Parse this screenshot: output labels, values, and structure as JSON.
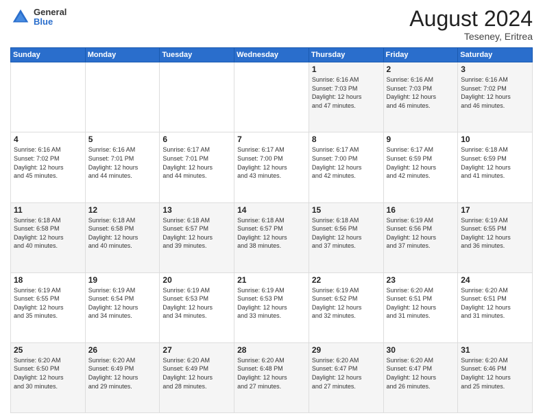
{
  "logo": {
    "general": "General",
    "blue": "Blue"
  },
  "title": "August 2024",
  "subtitle": "Teseney, Eritrea",
  "days_header": [
    "Sunday",
    "Monday",
    "Tuesday",
    "Wednesday",
    "Thursday",
    "Friday",
    "Saturday"
  ],
  "weeks": [
    [
      {
        "day": "",
        "info": ""
      },
      {
        "day": "",
        "info": ""
      },
      {
        "day": "",
        "info": ""
      },
      {
        "day": "",
        "info": ""
      },
      {
        "day": "1",
        "info": "Sunrise: 6:16 AM\nSunset: 7:03 PM\nDaylight: 12 hours\nand 47 minutes."
      },
      {
        "day": "2",
        "info": "Sunrise: 6:16 AM\nSunset: 7:03 PM\nDaylight: 12 hours\nand 46 minutes."
      },
      {
        "day": "3",
        "info": "Sunrise: 6:16 AM\nSunset: 7:02 PM\nDaylight: 12 hours\nand 46 minutes."
      }
    ],
    [
      {
        "day": "4",
        "info": "Sunrise: 6:16 AM\nSunset: 7:02 PM\nDaylight: 12 hours\nand 45 minutes."
      },
      {
        "day": "5",
        "info": "Sunrise: 6:16 AM\nSunset: 7:01 PM\nDaylight: 12 hours\nand 44 minutes."
      },
      {
        "day": "6",
        "info": "Sunrise: 6:17 AM\nSunset: 7:01 PM\nDaylight: 12 hours\nand 44 minutes."
      },
      {
        "day": "7",
        "info": "Sunrise: 6:17 AM\nSunset: 7:00 PM\nDaylight: 12 hours\nand 43 minutes."
      },
      {
        "day": "8",
        "info": "Sunrise: 6:17 AM\nSunset: 7:00 PM\nDaylight: 12 hours\nand 42 minutes."
      },
      {
        "day": "9",
        "info": "Sunrise: 6:17 AM\nSunset: 6:59 PM\nDaylight: 12 hours\nand 42 minutes."
      },
      {
        "day": "10",
        "info": "Sunrise: 6:18 AM\nSunset: 6:59 PM\nDaylight: 12 hours\nand 41 minutes."
      }
    ],
    [
      {
        "day": "11",
        "info": "Sunrise: 6:18 AM\nSunset: 6:58 PM\nDaylight: 12 hours\nand 40 minutes."
      },
      {
        "day": "12",
        "info": "Sunrise: 6:18 AM\nSunset: 6:58 PM\nDaylight: 12 hours\nand 40 minutes."
      },
      {
        "day": "13",
        "info": "Sunrise: 6:18 AM\nSunset: 6:57 PM\nDaylight: 12 hours\nand 39 minutes."
      },
      {
        "day": "14",
        "info": "Sunrise: 6:18 AM\nSunset: 6:57 PM\nDaylight: 12 hours\nand 38 minutes."
      },
      {
        "day": "15",
        "info": "Sunrise: 6:18 AM\nSunset: 6:56 PM\nDaylight: 12 hours\nand 37 minutes."
      },
      {
        "day": "16",
        "info": "Sunrise: 6:19 AM\nSunset: 6:56 PM\nDaylight: 12 hours\nand 37 minutes."
      },
      {
        "day": "17",
        "info": "Sunrise: 6:19 AM\nSunset: 6:55 PM\nDaylight: 12 hours\nand 36 minutes."
      }
    ],
    [
      {
        "day": "18",
        "info": "Sunrise: 6:19 AM\nSunset: 6:55 PM\nDaylight: 12 hours\nand 35 minutes."
      },
      {
        "day": "19",
        "info": "Sunrise: 6:19 AM\nSunset: 6:54 PM\nDaylight: 12 hours\nand 34 minutes."
      },
      {
        "day": "20",
        "info": "Sunrise: 6:19 AM\nSunset: 6:53 PM\nDaylight: 12 hours\nand 34 minutes."
      },
      {
        "day": "21",
        "info": "Sunrise: 6:19 AM\nSunset: 6:53 PM\nDaylight: 12 hours\nand 33 minutes."
      },
      {
        "day": "22",
        "info": "Sunrise: 6:19 AM\nSunset: 6:52 PM\nDaylight: 12 hours\nand 32 minutes."
      },
      {
        "day": "23",
        "info": "Sunrise: 6:20 AM\nSunset: 6:51 PM\nDaylight: 12 hours\nand 31 minutes."
      },
      {
        "day": "24",
        "info": "Sunrise: 6:20 AM\nSunset: 6:51 PM\nDaylight: 12 hours\nand 31 minutes."
      }
    ],
    [
      {
        "day": "25",
        "info": "Sunrise: 6:20 AM\nSunset: 6:50 PM\nDaylight: 12 hours\nand 30 minutes."
      },
      {
        "day": "26",
        "info": "Sunrise: 6:20 AM\nSunset: 6:49 PM\nDaylight: 12 hours\nand 29 minutes."
      },
      {
        "day": "27",
        "info": "Sunrise: 6:20 AM\nSunset: 6:49 PM\nDaylight: 12 hours\nand 28 minutes."
      },
      {
        "day": "28",
        "info": "Sunrise: 6:20 AM\nSunset: 6:48 PM\nDaylight: 12 hours\nand 27 minutes."
      },
      {
        "day": "29",
        "info": "Sunrise: 6:20 AM\nSunset: 6:47 PM\nDaylight: 12 hours\nand 27 minutes."
      },
      {
        "day": "30",
        "info": "Sunrise: 6:20 AM\nSunset: 6:47 PM\nDaylight: 12 hours\nand 26 minutes."
      },
      {
        "day": "31",
        "info": "Sunrise: 6:20 AM\nSunset: 6:46 PM\nDaylight: 12 hours\nand 25 minutes."
      }
    ]
  ]
}
